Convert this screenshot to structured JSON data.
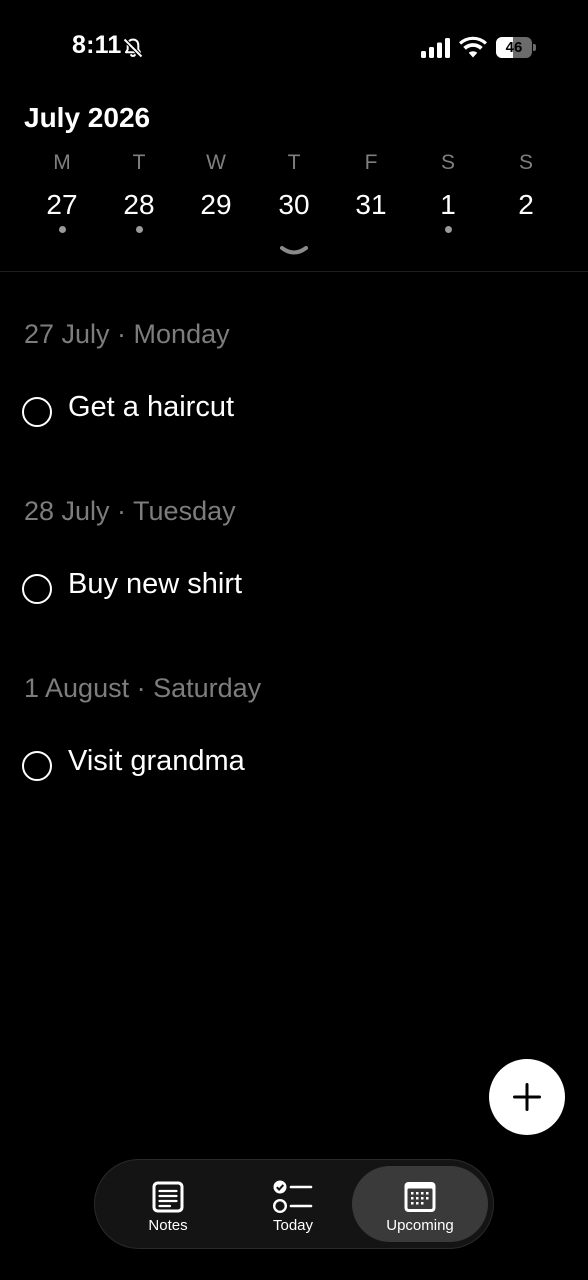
{
  "status_bar": {
    "time": "8:11",
    "battery_level": "46",
    "battery_fraction": 0.46,
    "icons": [
      "bell-slash-icon",
      "cellular-signal-icon",
      "wifi-icon",
      "battery-icon"
    ]
  },
  "calendar": {
    "month_title": "July 2026",
    "days": [
      {
        "letter": "M",
        "number": "27",
        "has_tasks": true
      },
      {
        "letter": "T",
        "number": "28",
        "has_tasks": true
      },
      {
        "letter": "W",
        "number": "29",
        "has_tasks": false
      },
      {
        "letter": "T",
        "number": "30",
        "has_tasks": false
      },
      {
        "letter": "F",
        "number": "31",
        "has_tasks": false
      },
      {
        "letter": "S",
        "number": "1",
        "has_tasks": true
      },
      {
        "letter": "S",
        "number": "2",
        "has_tasks": false
      }
    ],
    "expand_icon": "chevron-down-icon"
  },
  "sections": [
    {
      "header": "27 July · Monday",
      "tasks": [
        {
          "label": "Get a haircut",
          "done": false
        }
      ]
    },
    {
      "header": "28 July · Tuesday",
      "tasks": [
        {
          "label": "Buy new shirt",
          "done": false
        }
      ]
    },
    {
      "header": "1 August · Saturday",
      "tasks": [
        {
          "label": "Visit grandma",
          "done": false
        }
      ]
    }
  ],
  "fab": {
    "icon": "plus-icon"
  },
  "tab_bar": {
    "tabs": [
      {
        "label": "Notes",
        "icon": "notes-icon",
        "active": false
      },
      {
        "label": "Today",
        "icon": "checklist-icon",
        "active": false
      },
      {
        "label": "Upcoming",
        "icon": "calendar-icon",
        "active": true
      }
    ]
  },
  "colors": {
    "background": "#000000",
    "text": "#ffffff",
    "muted_text": "#7d7d7d",
    "active_tab": "#3a3a3a",
    "tab_bar": "#141414",
    "dot": "#9a9a9a"
  }
}
